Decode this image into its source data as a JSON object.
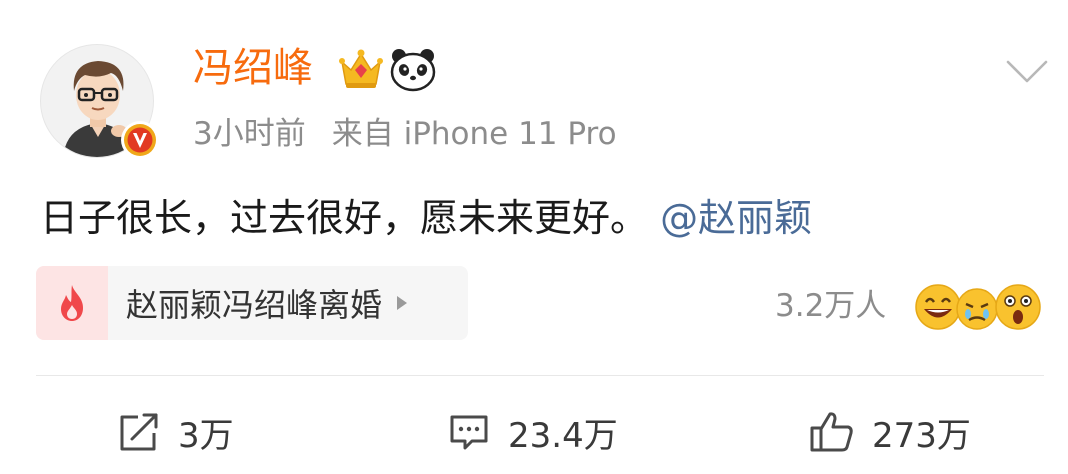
{
  "post": {
    "author": "冯绍峰",
    "time": "3小时前",
    "source": "来自 iPhone 11 Pro",
    "text": "日子很长，过去很好，愿未来更好。",
    "mention": "@赵丽颖",
    "badges": [
      "crown-badge-icon",
      "panda-badge-icon"
    ],
    "verified_icon": "verified-v-icon"
  },
  "topic": {
    "icon": "fire-icon",
    "label": "赵丽颖冯绍峰离婚"
  },
  "reactions": {
    "count": "3.2万人",
    "emojis": [
      "laugh-emoji",
      "cry-emoji",
      "surprised-emoji"
    ]
  },
  "actions": {
    "repost": "3万",
    "comment": "23.4万",
    "like": "273万"
  },
  "colors": {
    "author": "#f76b0e",
    "mention": "#4a6b97",
    "meta": "#8c8c8c",
    "topic_bg": "#f6f6f6",
    "topic_icon_bg": "#fde4e4",
    "fire": "#f0484b"
  }
}
